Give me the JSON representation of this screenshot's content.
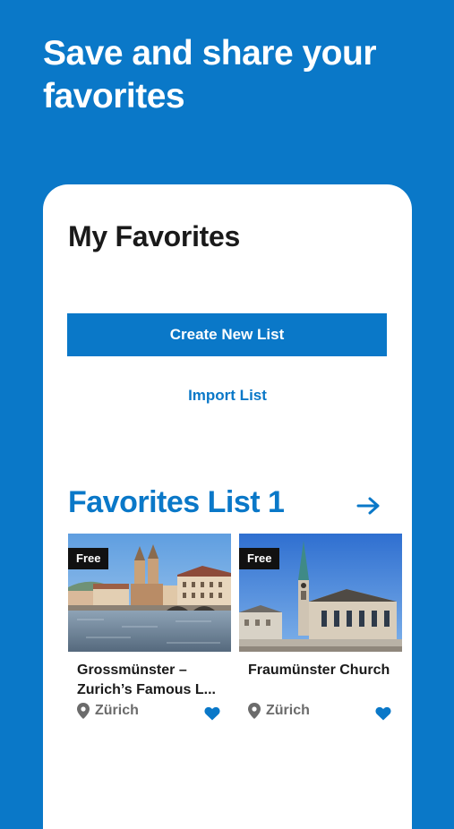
{
  "headline": {
    "line1": "Save and share your",
    "line2": "favorites"
  },
  "screen": {
    "title": "My Favorites",
    "create_button_label": "Create New List",
    "import_link_label": "Import List"
  },
  "favorites_list": {
    "title": "Favorites List 1",
    "arrow_icon": "arrow-right-icon",
    "items": [
      {
        "badge": "Free",
        "title_line1": "Grossmünster –",
        "title_line2": "Zurich’s Famous L...",
        "location": "Zürich",
        "location_icon": "location-pin-icon",
        "favorite_icon": "heart-icon"
      },
      {
        "badge": "Free",
        "title_line1": "Fraumünster Church",
        "title_line2": "",
        "location": "Zürich",
        "location_icon": "location-pin-icon",
        "favorite_icon": "heart-icon"
      }
    ]
  },
  "colors": {
    "brand_blue": "#0a78c8",
    "badge_black": "#111111",
    "text_dark": "#1a1a1a",
    "text_muted": "#6b6b6b"
  }
}
